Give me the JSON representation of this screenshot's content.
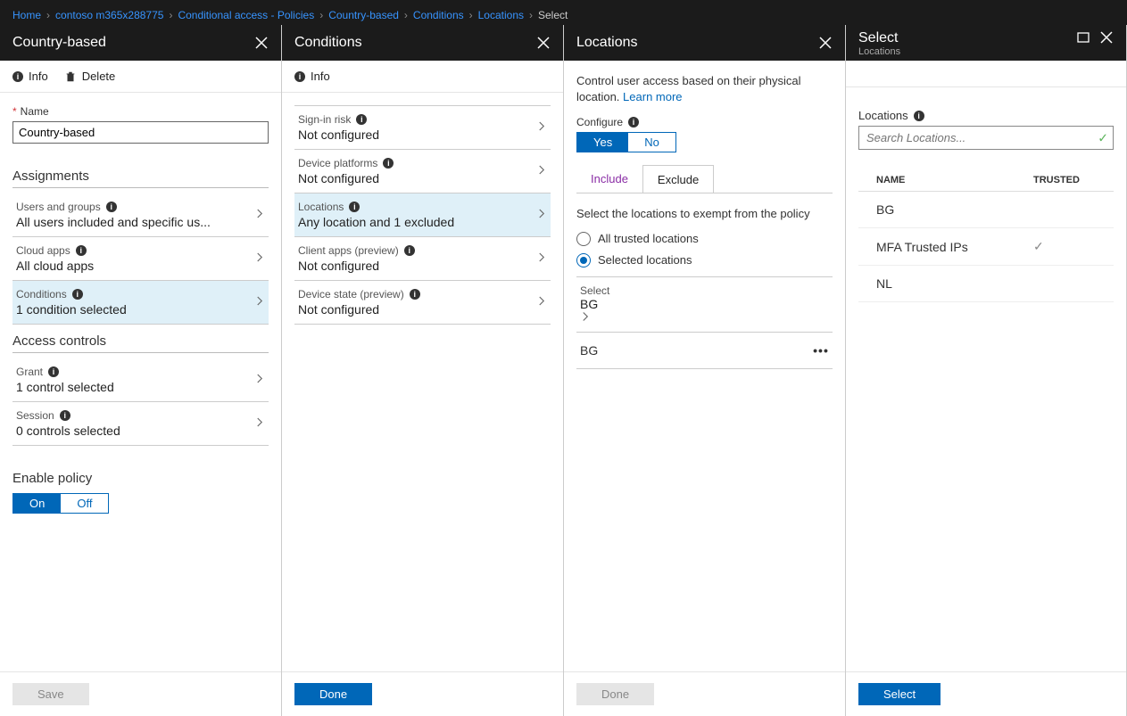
{
  "breadcrumb": {
    "items": [
      "Home",
      "contoso m365x288775",
      "Conditional access - Policies",
      "Country-based",
      "Conditions",
      "Locations"
    ],
    "current": "Select"
  },
  "blade1": {
    "title": "Country-based",
    "info": "Info",
    "delete": "Delete",
    "name_label": "Name",
    "name_value": "Country-based",
    "assignments_title": "Assignments",
    "rows": [
      {
        "label": "Users and groups",
        "value": "All users included and specific us...",
        "selected": false
      },
      {
        "label": "Cloud apps",
        "value": "All cloud apps",
        "selected": false
      },
      {
        "label": "Conditions",
        "value": "1 condition selected",
        "selected": true
      }
    ],
    "access_title": "Access controls",
    "access_rows": [
      {
        "label": "Grant",
        "value": "1 control selected"
      },
      {
        "label": "Session",
        "value": "0 controls selected"
      }
    ],
    "enable_title": "Enable policy",
    "on": "On",
    "off": "Off",
    "save": "Save"
  },
  "blade2": {
    "title": "Conditions",
    "info": "Info",
    "rows": [
      {
        "label": "Sign-in risk",
        "value": "Not configured",
        "selected": false
      },
      {
        "label": "Device platforms",
        "value": "Not configured",
        "selected": false
      },
      {
        "label": "Locations",
        "value": "Any location and 1 excluded",
        "selected": true
      },
      {
        "label": "Client apps (preview)",
        "value": "Not configured",
        "selected": false
      },
      {
        "label": "Device state (preview)",
        "value": "Not configured",
        "selected": false
      }
    ],
    "done": "Done"
  },
  "blade3": {
    "title": "Locations",
    "desc": "Control user access based on their physical location. ",
    "learn": "Learn more",
    "configure": "Configure",
    "yes": "Yes",
    "no": "No",
    "tab_include": "Include",
    "tab_exclude": "Exclude",
    "instruction": "Select the locations to exempt from the policy",
    "radio_trusted": "All trusted locations",
    "radio_selected": "Selected locations",
    "select_label": "Select",
    "select_value": "BG",
    "item": "BG",
    "done": "Done"
  },
  "blade4": {
    "title": "Select",
    "subtitle": "Locations",
    "loc_label": "Locations",
    "search_placeholder": "Search Locations...",
    "col_name": "NAME",
    "col_trusted": "TRUSTED",
    "rows": [
      {
        "name": "BG",
        "trusted": false
      },
      {
        "name": "MFA Trusted IPs",
        "trusted": true
      },
      {
        "name": "NL",
        "trusted": false
      }
    ],
    "select": "Select"
  }
}
